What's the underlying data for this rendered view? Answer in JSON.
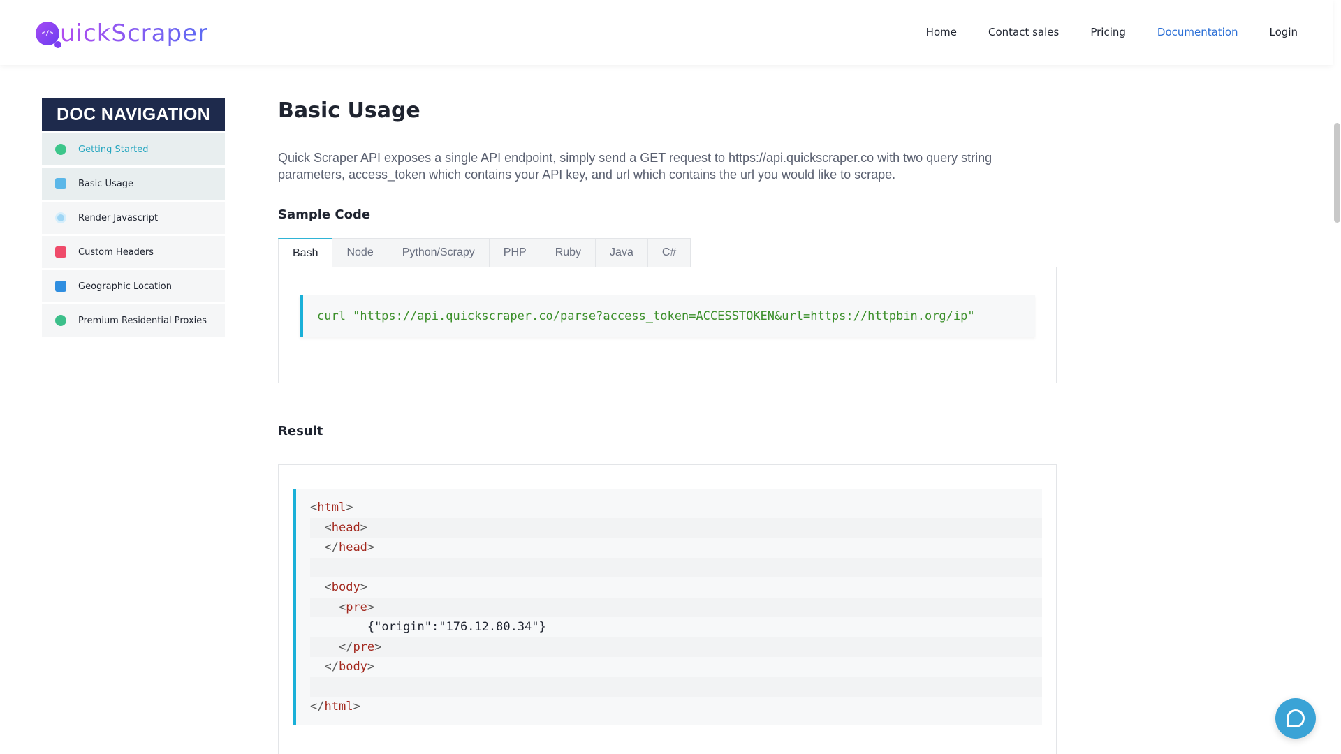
{
  "header": {
    "logo_mark": "</>",
    "logo_text": "uickScraper",
    "nav": [
      {
        "label": "Home"
      },
      {
        "label": "Contact sales"
      },
      {
        "label": "Pricing"
      },
      {
        "label": "Documentation"
      },
      {
        "label": "Login"
      }
    ],
    "active_nav": "Documentation"
  },
  "sidebar": {
    "title": "DOC NAVIGATION",
    "items": [
      {
        "label": "Getting Started",
        "icon": "rocket-icon"
      },
      {
        "label": "Basic Usage",
        "icon": "toolbox-icon"
      },
      {
        "label": "Render Javascript",
        "icon": "gear-icon"
      },
      {
        "label": "Custom Headers",
        "icon": "inbox-icon"
      },
      {
        "label": "Geographic Location",
        "icon": "book-icon"
      },
      {
        "label": "Premium Residential Proxies",
        "icon": "chat-icon"
      }
    ]
  },
  "main": {
    "title": "Basic Usage",
    "intro": "Quick Scraper API exposes a single API endpoint, simply send a GET request to https://api.quickscraper.co with two query string parameters, access_token which contains your API key, and url which contains the url you would like to scrape.",
    "sample_heading": "Sample Code",
    "tabs": [
      {
        "label": "Bash"
      },
      {
        "label": "Node"
      },
      {
        "label": "Python/Scrapy"
      },
      {
        "label": "PHP"
      },
      {
        "label": "Ruby"
      },
      {
        "label": "Java"
      },
      {
        "label": "C#"
      }
    ],
    "active_tab": "Bash",
    "sample_code": "curl \"https://api.quickscraper.co/parse?access_token=ACCESSTOKEN&url=https://httpbin.org/ip\"",
    "result_heading": "Result",
    "result_lines": [
      {
        "indent": "",
        "open": "<",
        "tag": "html",
        "close": ">",
        "text": ""
      },
      {
        "indent": "  ",
        "open": "<",
        "tag": "head",
        "close": ">",
        "text": ""
      },
      {
        "indent": "  ",
        "open": "</",
        "tag": "head",
        "close": ">",
        "text": ""
      },
      {
        "indent": "",
        "open": "",
        "tag": "",
        "close": "",
        "text": ""
      },
      {
        "indent": "  ",
        "open": "<",
        "tag": "body",
        "close": ">",
        "text": ""
      },
      {
        "indent": "    ",
        "open": "<",
        "tag": "pre",
        "close": ">",
        "text": ""
      },
      {
        "indent": "        ",
        "open": "",
        "tag": "",
        "close": "",
        "text": "{\"origin\":\"176.12.80.34\"}"
      },
      {
        "indent": "    ",
        "open": "</",
        "tag": "pre",
        "close": ">",
        "text": ""
      },
      {
        "indent": "  ",
        "open": "</",
        "tag": "body",
        "close": ">",
        "text": ""
      },
      {
        "indent": "",
        "open": "",
        "tag": "",
        "close": "",
        "text": ""
      },
      {
        "indent": "",
        "open": "</",
        "tag": "html",
        "close": ">",
        "text": ""
      }
    ]
  },
  "colors": {
    "sidebar_title_bg": "#1e2a4c",
    "accent": "#1ab0d8",
    "link_active": "#2b6fd6",
    "code_green": "#3b8f2a",
    "code_tag": "#a3281e"
  },
  "chat_widget": {
    "icon": "chat-bubble-icon"
  }
}
